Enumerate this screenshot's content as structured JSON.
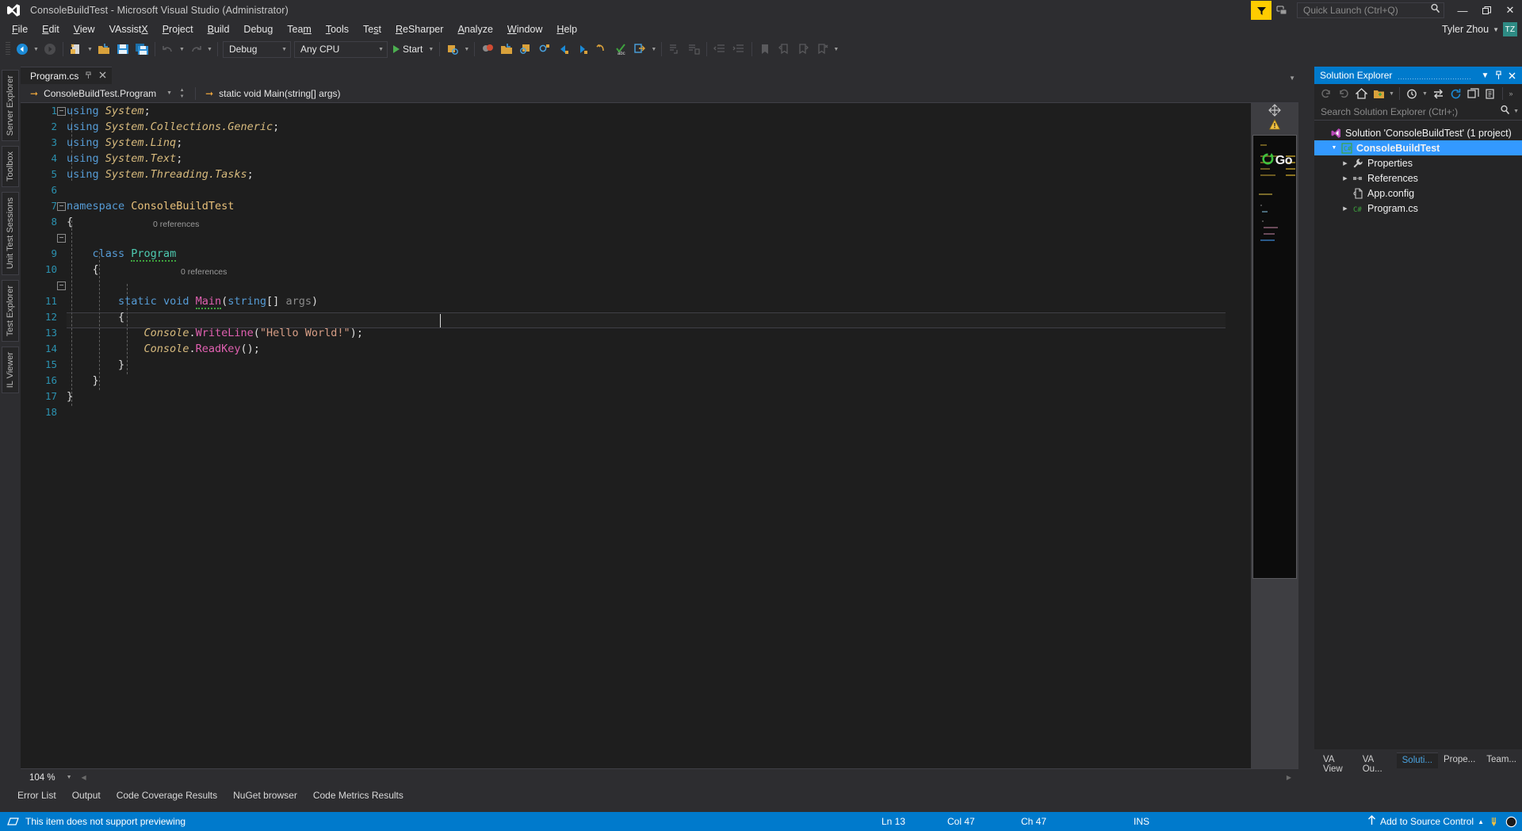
{
  "titlebar": {
    "title": "ConsoleBuildTest - Microsoft Visual Studio  (Administrator)",
    "logo_icon": "visual-studio-logo-icon",
    "resharper_icon": "resharper-badge-icon",
    "feedback_icon": "send-feedback-icon",
    "quick_launch_placeholder": "Quick Launch (Ctrl+Q)",
    "quick_launch_value": "",
    "search_icon": "search-icon",
    "minimize_label": "—",
    "restore_label": "❐",
    "close_label": "✕"
  },
  "menubar": {
    "items": [
      {
        "label": "File",
        "mnemonic": "F"
      },
      {
        "label": "Edit",
        "mnemonic": "E"
      },
      {
        "label": "View",
        "mnemonic": "V"
      },
      {
        "label": "VAssistX",
        "mnemonic": "X"
      },
      {
        "label": "Project",
        "mnemonic": "P"
      },
      {
        "label": "Build",
        "mnemonic": "B"
      },
      {
        "label": "Debug",
        "mnemonic": "g"
      },
      {
        "label": "Team",
        "mnemonic": "m"
      },
      {
        "label": "Tools",
        "mnemonic": "T"
      },
      {
        "label": "Test",
        "mnemonic": "s"
      },
      {
        "label": "ReSharper",
        "mnemonic": "R"
      },
      {
        "label": "Analyze",
        "mnemonic": "A"
      },
      {
        "label": "Window",
        "mnemonic": "W"
      },
      {
        "label": "Help",
        "mnemonic": "H"
      }
    ],
    "user_name": "Tyler Zhou",
    "user_initials": "TZ"
  },
  "toolbar": {
    "config_value": "Debug",
    "platform_value": "Any CPU",
    "start_label": "Start",
    "icons": [
      "navigate-back-icon",
      "navigate-forward-icon",
      "new-item-icon",
      "open-file-icon",
      "save-icon",
      "save-all-icon",
      "undo-icon",
      "redo-icon"
    ],
    "right_icons": [
      "attach-to-process-icon",
      "find-in-files-icon",
      "refactor-icon",
      "find-symbol-icon",
      "quick-find-icon",
      "step-back-icon",
      "step-forward-icon",
      "undo-parse-icon",
      "spell-check-icon",
      "goto-implementation-icon",
      "comment-icon",
      "uncomment-icon",
      "decrease-indent-icon",
      "increase-indent-icon",
      "bookmark-icon",
      "prev-bookmark-icon",
      "next-bookmark-icon",
      "clear-bookmarks-icon"
    ]
  },
  "left_tabs": [
    {
      "label": "Server Explorer"
    },
    {
      "label": "Toolbox"
    },
    {
      "label": "Unit Test Sessions"
    },
    {
      "label": "Test Explorer"
    },
    {
      "label": "IL Viewer"
    }
  ],
  "editor": {
    "tab_label": "Program.cs",
    "tab_pin_icon": "pin-icon",
    "tab_close_icon": "close-icon",
    "nav_left_value": "ConsoleBuildTest.Program",
    "nav_right_value": "static void Main(string[] args)",
    "go_label": "Go",
    "go_icon": "resharper-go-icon",
    "zoom_level": "104 %",
    "warning_icon": "warning-triangle-icon",
    "split_icon": "split-view-icon",
    "lines": [
      {
        "n": 1,
        "text": "using System;"
      },
      {
        "n": 2,
        "text": "using System.Collections.Generic;"
      },
      {
        "n": 3,
        "text": "using System.Linq;"
      },
      {
        "n": 4,
        "text": "using System.Text;"
      },
      {
        "n": 5,
        "text": "using System.Threading.Tasks;"
      },
      {
        "n": 6,
        "text": ""
      },
      {
        "n": 7,
        "text": "namespace ConsoleBuildTest"
      },
      {
        "n": 8,
        "text": "{"
      },
      {
        "n": 9,
        "text": "    class Program"
      },
      {
        "n": 10,
        "text": "    {"
      },
      {
        "n": 11,
        "text": "        static void Main(string[] args)"
      },
      {
        "n": 12,
        "text": "        {"
      },
      {
        "n": 13,
        "text": "            Console.WriteLine(\"Hello World!\");"
      },
      {
        "n": 14,
        "text": "            Console.ReadKey();"
      },
      {
        "n": 15,
        "text": "        }"
      },
      {
        "n": 16,
        "text": "    }"
      },
      {
        "n": 17,
        "text": "}"
      },
      {
        "n": 18,
        "text": ""
      }
    ],
    "codelens_class": "0 references",
    "codelens_main": "0 references"
  },
  "solution_explorer": {
    "title": "Solution Explorer",
    "dropdown_icon": "chevron-down-icon",
    "pin_icon": "pin-icon",
    "close_icon": "close-icon",
    "toolbar_icons": [
      "back-icon",
      "forward-icon",
      "home-icon",
      "show-all-files-icon",
      "pending-changes-icon",
      "sync-with-active-document-icon",
      "refresh-icon",
      "collapse-all-icon",
      "properties-window-icon"
    ],
    "search_placeholder": "Search Solution Explorer (Ctrl+;)",
    "search_value": "",
    "search_icon": "search-icon",
    "tree": [
      {
        "label": "Solution 'ConsoleBuildTest' (1 project)",
        "icon": "solution-icon",
        "indent": 0,
        "expander": "",
        "selected": false,
        "bold": false
      },
      {
        "label": "ConsoleBuildTest",
        "icon": "csharp-project-icon",
        "indent": 1,
        "expander": "expanded",
        "selected": true,
        "bold": true
      },
      {
        "label": "Properties",
        "icon": "properties-wrench-icon",
        "indent": 2,
        "expander": "collapsed",
        "selected": false,
        "bold": false
      },
      {
        "label": "References",
        "icon": "references-icon",
        "indent": 2,
        "expander": "collapsed",
        "selected": false,
        "bold": false
      },
      {
        "label": "App.config",
        "icon": "config-file-icon",
        "indent": 2,
        "expander": "",
        "selected": false,
        "bold": false
      },
      {
        "label": "Program.cs",
        "icon": "csharp-file-icon",
        "indent": 2,
        "expander": "collapsed",
        "selected": false,
        "bold": false
      }
    ],
    "bottom_tabs": [
      {
        "label": "VA View",
        "active": false
      },
      {
        "label": "VA Ou...",
        "active": false
      },
      {
        "label": "Soluti...",
        "active": true
      },
      {
        "label": "Prope...",
        "active": false
      },
      {
        "label": "Team...",
        "active": false
      }
    ]
  },
  "bottom_tabs": [
    {
      "label": "Error List"
    },
    {
      "label": "Output"
    },
    {
      "label": "Code Coverage Results"
    },
    {
      "label": "NuGet browser"
    },
    {
      "label": "Code Metrics Results"
    }
  ],
  "statusbar": {
    "status_icon": "preview-icon",
    "message": "This item does not support previewing",
    "line": "Ln 13",
    "col": "Col 47",
    "ch": "Ch 47",
    "ins": "INS",
    "source_control_icon": "upload-arrow-icon",
    "source_control": "Add to Source Control",
    "source_control_caret": "▲",
    "notify_icon": "notifications-icon",
    "fullscreen_icon": "circle-icon"
  },
  "colors": {
    "accent": "#007acc",
    "chrome": "#2d2d30",
    "panel": "#252526",
    "editor_bg": "#1e1e1e",
    "selection": "#3399ff",
    "keyword": "#569cd6",
    "type": "#4ec9b0",
    "namespace": "#d7ba7d",
    "string": "#d69d85",
    "method": "#e060b0",
    "linenumber": "#2b91af",
    "resharper_yellow": "#ffcc00",
    "avatar": "#2e8b84"
  }
}
